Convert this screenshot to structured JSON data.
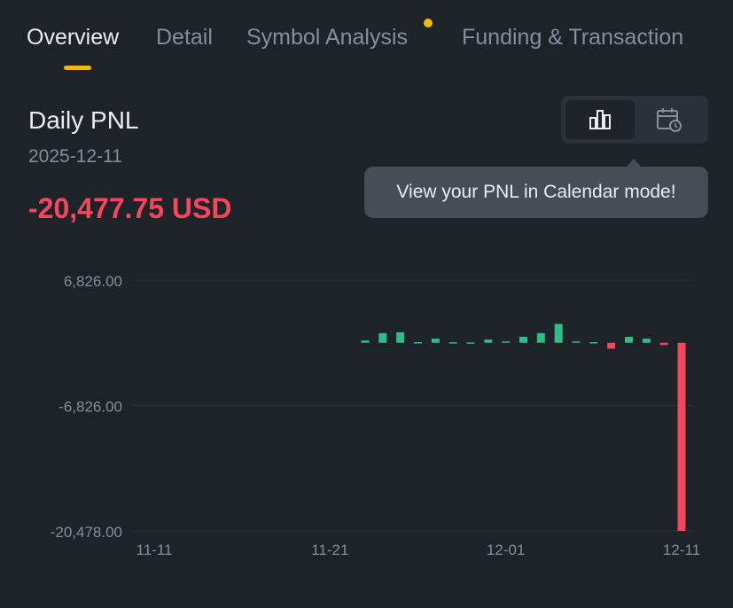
{
  "tabs": [
    {
      "label": "Overview",
      "active": true
    },
    {
      "label": "Detail",
      "active": false
    },
    {
      "label": "Symbol Analysis",
      "active": false,
      "has_dot": true
    },
    {
      "label": "Funding & Transaction",
      "active": false
    }
  ],
  "header": {
    "title": "Daily PNL",
    "date": "2025-12-11",
    "pnl": "-20,477.75 USD"
  },
  "view_toggle": {
    "options": [
      {
        "icon": "bar-chart-icon",
        "active": true
      },
      {
        "icon": "calendar-icon",
        "active": false
      }
    ]
  },
  "tooltip": {
    "text": "View your PNL in Calendar mode!"
  },
  "colors": {
    "background": "#1e2329",
    "positive": "#2ebd85",
    "negative": "#f6465d",
    "accent": "#f0b90b",
    "muted_text": "#848e9c"
  },
  "chart_data": {
    "type": "bar",
    "y_tick_labels": [
      "6,826.00",
      "-6,826.00",
      "-20,478.00"
    ],
    "y_ticks": [
      6826,
      -6826,
      -20478
    ],
    "ylim": [
      -20478,
      6826
    ],
    "x_tick_labels": [
      "11-11",
      "11-21",
      "12-01",
      "12-11"
    ],
    "categories": [
      "11-11",
      "11-12",
      "11-13",
      "11-14",
      "11-15",
      "11-16",
      "11-17",
      "11-18",
      "11-19",
      "11-20",
      "11-21",
      "11-22",
      "11-23",
      "11-24",
      "11-25",
      "11-26",
      "11-27",
      "11-28",
      "11-29",
      "11-30",
      "12-01",
      "12-02",
      "12-03",
      "12-04",
      "12-05",
      "12-06",
      "12-07",
      "12-08",
      "12-09",
      "12-10",
      "12-11"
    ],
    "values": [
      0,
      0,
      0,
      0,
      0,
      0,
      0,
      0,
      0,
      0,
      0,
      0,
      250,
      1050,
      1150,
      70,
      450,
      60,
      40,
      350,
      150,
      650,
      1050,
      2050,
      150,
      70,
      -650,
      650,
      450,
      -250,
      -20477.75
    ],
    "grid": true
  }
}
